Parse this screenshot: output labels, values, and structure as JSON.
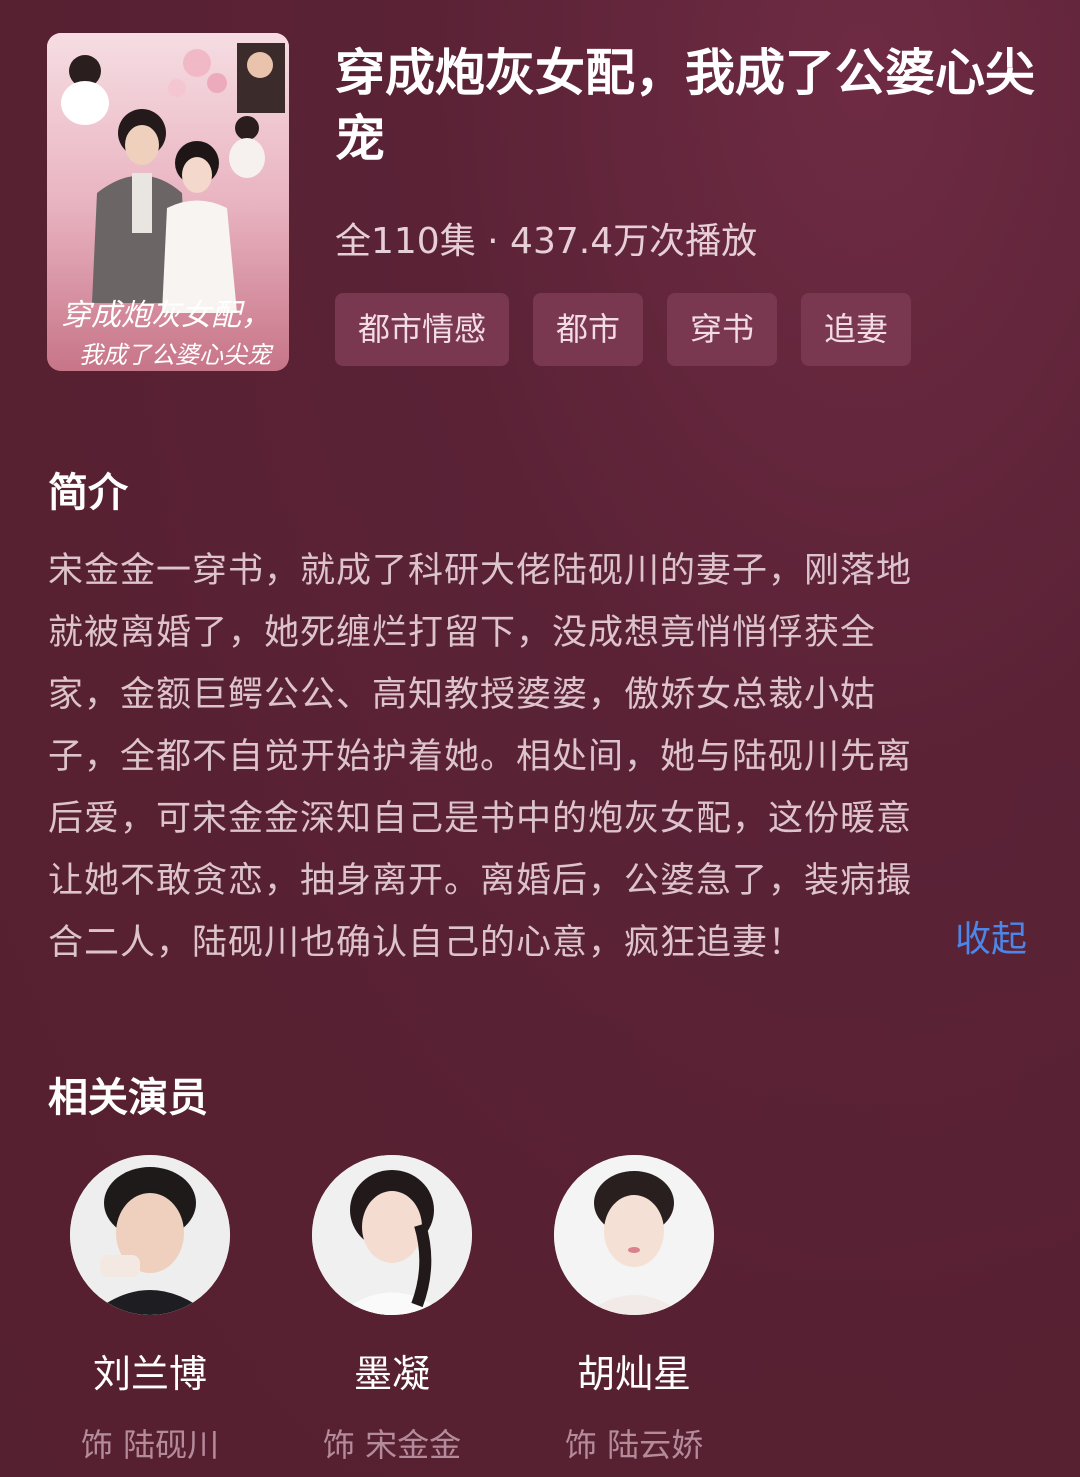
{
  "drama": {
    "title": "穿成炮灰女配，我成了公婆心尖宠",
    "meta": "全110集 · 437.4万次播放",
    "tags": [
      "都市情感",
      "都市",
      "穿书",
      "追妻"
    ]
  },
  "poster": {
    "calligraphy_line1": "穿成炮灰女配，",
    "calligraphy_line2": "我成了公婆心尖宠"
  },
  "synopsis": {
    "heading": "简介",
    "lines": [
      "宋金金一穿书，就成了科研大佬陆砚川的妻子，刚落地",
      "就被离婚了，她死缠烂打留下，没成想竟悄悄俘获全",
      "家，金额巨鳄公公、高知教授婆婆，傲娇女总裁小姑",
      "子，全都不自觉开始护着她。相处间，她与陆砚川先离",
      "后爱，可宋金金深知自己是书中的炮灰女配，这份暖意",
      "让她不敢贪恋，抽身离开。离婚后，公婆急了，装病撮",
      "合二人，陆砚川也确认自己的心意，疯狂追妻！"
    ],
    "collapse_label": "收起"
  },
  "actors": {
    "heading": "相关演员",
    "list": [
      {
        "name": "刘兰博",
        "role": "饰 陆砚川"
      },
      {
        "name": "墨凝",
        "role": "饰 宋金金"
      },
      {
        "name": "胡灿星",
        "role": "饰 陆云娇"
      }
    ]
  },
  "colors": {
    "background": "#5a2236",
    "tag_bg": "#7a3750",
    "link": "#4b86e8"
  }
}
